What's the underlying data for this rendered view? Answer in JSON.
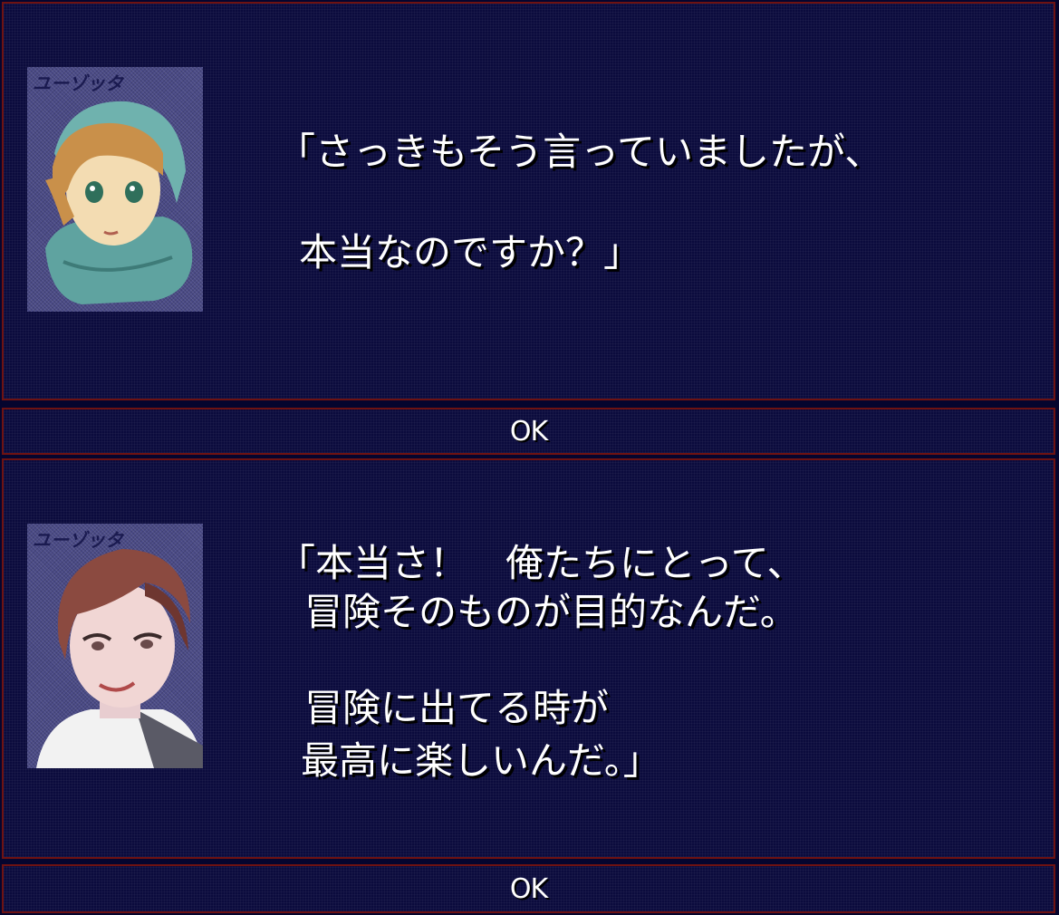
{
  "dialogs": [
    {
      "portrait_tag": "ユーゾッタ",
      "lines": [
        "「さっきもそう言っていましたが、",
        "本当なのですか？」"
      ]
    },
    {
      "portrait_tag": "ユーゾッタ",
      "lines": [
        "「本当さ！　俺たちにとって、",
        "冒険そのものが目的なんだ。",
        "冒険に出てる時が",
        "最高に楽しいんだ。」"
      ]
    }
  ],
  "buttons": {
    "ok_1": "OK",
    "ok_2": "OK"
  },
  "colors": {
    "panel_bg": "#0b0b3d",
    "panel_border": "#6e1212",
    "text": "#ffffff"
  }
}
